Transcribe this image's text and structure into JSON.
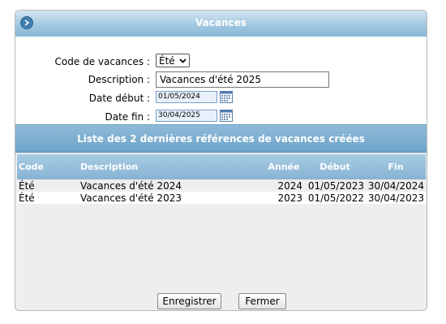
{
  "dialog": {
    "title": "Vacances"
  },
  "form": {
    "code_label": "Code de vacances :",
    "code_value": "Été",
    "description_label": "Description :",
    "description_value": "Vacances d'été 2025",
    "start_label": "Date début :",
    "start_value": "01/05/2024",
    "end_label": "Date fin :",
    "end_value": "30/04/2025"
  },
  "list": {
    "title": "Liste des 2 dernières références de vacances créées",
    "columns": {
      "code": "Code",
      "description": "Description",
      "year": "Année",
      "start": "Début",
      "end": "Fin"
    },
    "rows": [
      {
        "code": "Été",
        "description": "Vacances d'été 2024",
        "year": "2024",
        "start": "01/05/2023",
        "end": "30/04/2024"
      },
      {
        "code": "Été",
        "description": "Vacances d'été 2023",
        "year": "2023",
        "start": "01/05/2022",
        "end": "30/04/2023"
      }
    ]
  },
  "buttons": {
    "save": "Enregistrer",
    "close": "Fermer"
  },
  "icons": {
    "title_button": "arrow-right-icon",
    "calendar": "calendar-icon"
  },
  "colors": {
    "header_blue": "#8ab7d5",
    "title_text": "#ffffff"
  }
}
